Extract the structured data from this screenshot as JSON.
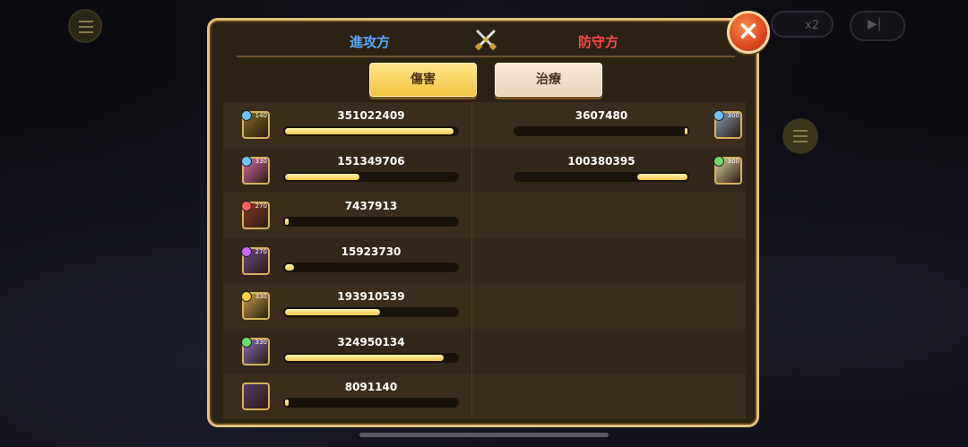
{
  "header": {
    "attacker_label": "進攻方",
    "defender_label": "防守方",
    "close_icon": "×"
  },
  "tabs": [
    {
      "label": "傷害",
      "active": true
    },
    {
      "label": "治療",
      "active": false
    }
  ],
  "hud": {
    "speed_label": "x2"
  },
  "attackers": [
    {
      "value": "351022409",
      "fill": 0.98,
      "level": "140",
      "badge": "#6fc4ff",
      "color": "#8a6a24"
    },
    {
      "value": "151349706",
      "fill": 0.43,
      "level": "330",
      "badge": "#6fc4ff",
      "color": "#d86aa8"
    },
    {
      "value": "7437913",
      "fill": 0.02,
      "level": "270",
      "badge": "#ff6060",
      "color": "#8a3a2a"
    },
    {
      "value": "15923730",
      "fill": 0.05,
      "level": "270",
      "badge": "#c86aff",
      "color": "#6a4a8a"
    },
    {
      "value": "193910539",
      "fill": 0.55,
      "level": "330",
      "badge": "#ffd24a",
      "color": "#c8a04a"
    },
    {
      "value": "324950134",
      "fill": 0.92,
      "level": "330",
      "badge": "#6fdc6a",
      "color": "#8a6ab8"
    },
    {
      "value": "8091140",
      "fill": 0.02,
      "level": "",
      "badge": "",
      "color": "#5a3a6a"
    }
  ],
  "defenders": [
    {
      "value": "3607480",
      "fill": 0.01,
      "level": "300",
      "badge": "#6fc4ff",
      "color": "#8a9ab8"
    },
    {
      "value": "100380395",
      "fill": 0.29,
      "level": "300",
      "badge": "#6fdc6a",
      "color": "#d8d0a0"
    }
  ]
}
